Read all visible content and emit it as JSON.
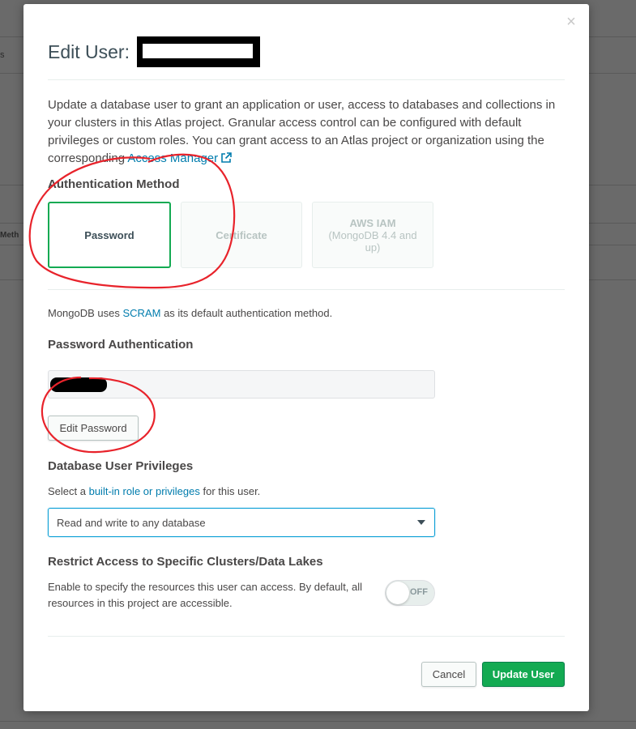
{
  "background": {
    "left_fragment_1": "s",
    "left_fragment_2": "Meth"
  },
  "modal": {
    "title": "Edit User:",
    "description_text": "Update a database user to grant an application or user, access to databases and collections in your clusters in this Atlas project. Granular access control can be configured with default privileges or custom roles. You can grant access to an Atlas project or organization using the corresponding ",
    "access_manager_link": "Access Manager",
    "external_link_icon": "external-link-icon",
    "close_icon": "close-icon"
  },
  "auth_method": {
    "heading": "Authentication Method",
    "options": [
      {
        "label": "Password",
        "sub": "",
        "selected": true
      },
      {
        "label": "Certificate",
        "sub": "",
        "selected": false
      },
      {
        "label": "AWS IAM",
        "sub": "(MongoDB 4.4 and up)",
        "selected": false
      }
    ],
    "note_prefix": "MongoDB uses ",
    "note_link": "SCRAM",
    "note_suffix": " as its default authentication method."
  },
  "password_auth": {
    "heading": "Password Authentication",
    "edit_button": "Edit Password"
  },
  "privileges": {
    "heading": "Database User Privileges",
    "note_prefix": "Select a ",
    "note_link": "built-in role or privileges",
    "note_suffix": " for this user.",
    "selected_value": "Read and write to any database"
  },
  "restrict": {
    "heading": "Restrict Access to Specific Clusters/Data Lakes",
    "description": "Enable to specify the resources this user can access. By default, all resources in this project are accessible.",
    "toggle_label": "OFF"
  },
  "footer": {
    "cancel_label": "Cancel",
    "update_label": "Update User"
  },
  "colors": {
    "primary_green": "#13aa52",
    "link_blue": "#007cad",
    "annotation_red": "#e8232b"
  }
}
